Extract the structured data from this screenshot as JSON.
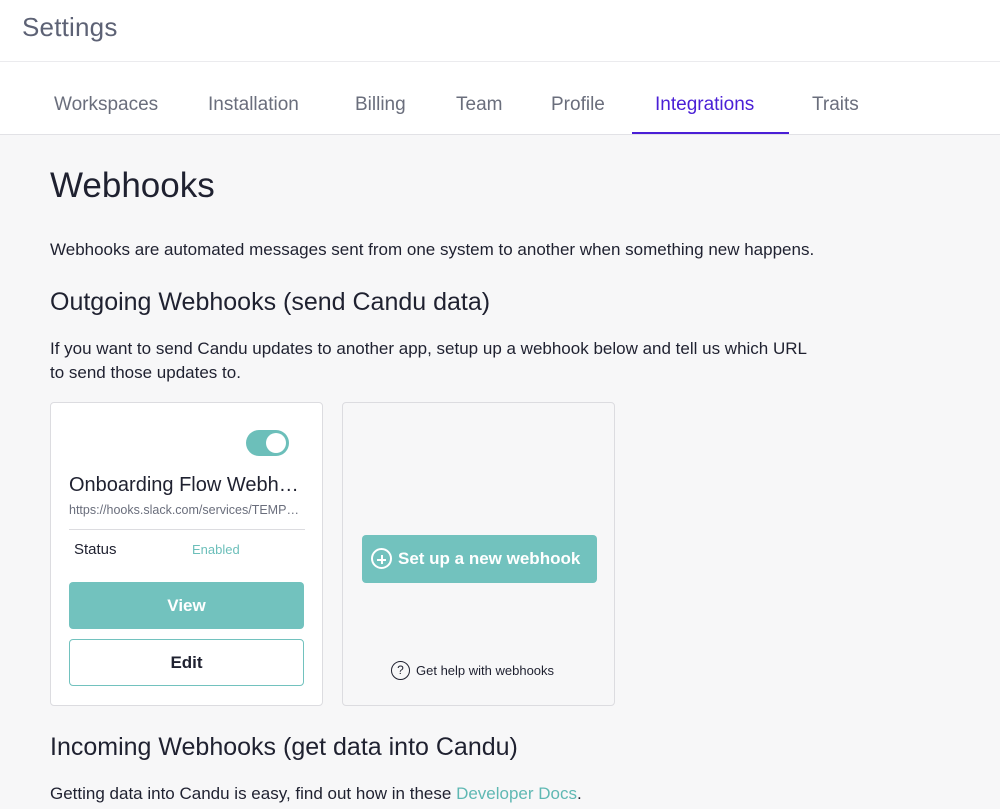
{
  "header": {
    "title": "Settings"
  },
  "tabs": [
    {
      "label": "Workspaces"
    },
    {
      "label": "Installation"
    },
    {
      "label": "Billing"
    },
    {
      "label": "Team"
    },
    {
      "label": "Profile"
    },
    {
      "label": "Integrations",
      "active": true
    },
    {
      "label": "Traits"
    }
  ],
  "page": {
    "title": "Webhooks",
    "description": "Webhooks are automated messages sent from one system to another when something new happens."
  },
  "outgoing": {
    "title": "Outgoing Webhooks (send Candu data)",
    "description_line1": "If you want to send Candu updates to another app, setup up a webhook below and tell us which URL",
    "description_line2": "to send those updates to."
  },
  "webhook_card": {
    "name": "Onboarding Flow Webhook",
    "url": "https://hooks.slack.com/services/TEMPLATE",
    "status_label": "Status",
    "status_value": "Enabled",
    "enabled": true,
    "view_label": "View",
    "edit_label": "Edit"
  },
  "new_card": {
    "button_label": "Set up a new webhook",
    "help_label": "Get help with webhooks",
    "help_icon_glyph": "?"
  },
  "incoming": {
    "title": "Incoming Webhooks (get data into Candu)",
    "description_prefix": "Getting data into Candu is easy, find out how in these ",
    "link_text": "Developer Docs",
    "description_suffix": "."
  },
  "colors": {
    "accent": "#4a1fd6",
    "teal": "#72c2be",
    "text": "#1f2130",
    "muted": "#6a6e7c"
  },
  "icons": [
    "plus-circle-icon",
    "question-circle-icon",
    "toggle-switch"
  ]
}
